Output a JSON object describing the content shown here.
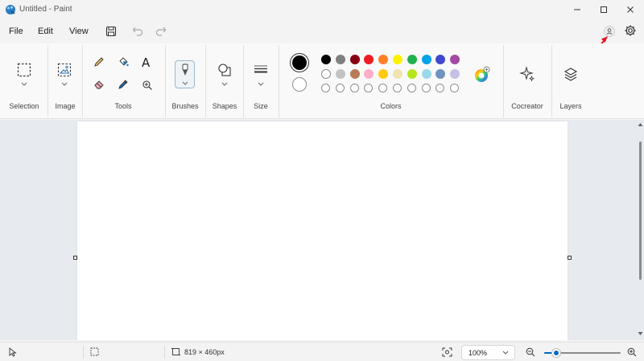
{
  "window": {
    "title": "Untitled - Paint",
    "controls": [
      "minimize",
      "maximize",
      "close"
    ]
  },
  "menu": {
    "items": [
      "File",
      "Edit",
      "View"
    ],
    "quick_actions": [
      "save-icon",
      "undo-icon",
      "redo-icon"
    ]
  },
  "ribbon": {
    "groups": {
      "selection": "Selection",
      "image": "Image",
      "tools": "Tools",
      "brushes": "Brushes",
      "shapes": "Shapes",
      "size": "Size",
      "colors": "Colors",
      "cocreator": "Cocreator",
      "layers": "Layers"
    },
    "tools": [
      "pencil-icon",
      "fill-bucket-icon",
      "text-icon",
      "eraser-icon",
      "color-picker-icon",
      "magnifier-icon"
    ],
    "text_tool_glyph": "A"
  },
  "colors": {
    "primary": "#000000",
    "secondary": "#ffffff",
    "palette_row1": [
      "#000000",
      "#7f7f7f",
      "#880015",
      "#ed1c24",
      "#ff7f27",
      "#fff200",
      "#22b14c",
      "#00a2e8",
      "#3f48cc",
      "#a349a4"
    ],
    "palette_row2": [
      "#ffffff",
      "#c3c3c3",
      "#b97a57",
      "#ffaec9",
      "#ffc90e",
      "#efe4b0",
      "#b5e61d",
      "#99d9ea",
      "#7092be",
      "#c8bfe7"
    ],
    "custom_slots": 10,
    "accent": "#0067c0",
    "annotation_arrow": "#e81123"
  },
  "status": {
    "canvas_size": "819 × 460px",
    "zoom_level": "100%",
    "zoom_fraction": 0.16
  }
}
